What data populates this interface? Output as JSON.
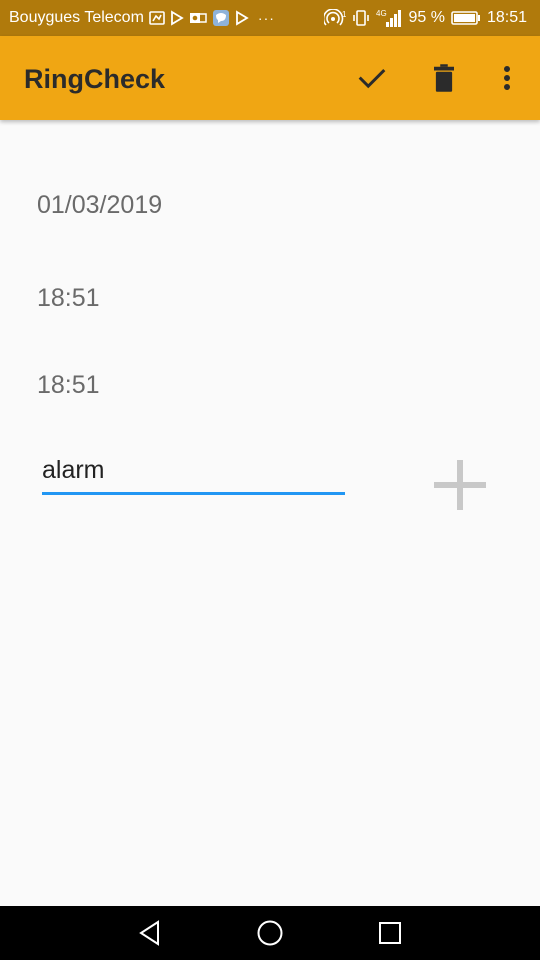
{
  "status_bar": {
    "carrier": "Bouygues Telecom",
    "more_indicator": "···",
    "roaming_badge": "1",
    "network_type": "4G",
    "battery_percent": "95 %",
    "time": "18:51",
    "left_icons": [
      "maps-icon",
      "play-icon",
      "outlook-icon",
      "messenger-icon",
      "play-icon"
    ],
    "right_icons": [
      "hotspot-icon",
      "vibrate-icon",
      "signal-icon",
      "battery-icon"
    ]
  },
  "app_bar": {
    "title": "RingCheck",
    "actions": [
      "check-icon",
      "delete-icon",
      "more-vert-icon"
    ],
    "color": "#f0a613"
  },
  "form": {
    "date": "01/03/2019",
    "time_start": "18:51",
    "time_end": "18:51",
    "label_value": "alarm",
    "accent_color": "#2196f3",
    "add_icon": "plus-icon"
  },
  "nav_bar": {
    "buttons": [
      "back-icon",
      "home-icon",
      "recents-icon"
    ]
  }
}
